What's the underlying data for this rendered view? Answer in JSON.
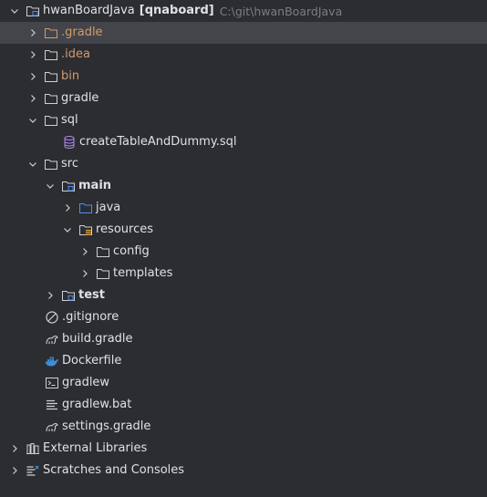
{
  "project": {
    "name": "hwanBoardJava",
    "module": "[qnaboard]",
    "path": "C:\\git\\hwanBoardJava"
  },
  "items": {
    "gradle_hidden": ".gradle",
    "idea": ".idea",
    "bin": "bin",
    "gradle": "gradle",
    "sql": "sql",
    "sql_file": "createTableAndDummy.sql",
    "src": "src",
    "main": "main",
    "java": "java",
    "resources": "resources",
    "config": "config",
    "templates": "templates",
    "test": "test",
    "gitignore": ".gitignore",
    "build_gradle": "build.gradle",
    "dockerfile": "Dockerfile",
    "gradlew": "gradlew",
    "gradlew_bat": "gradlew.bat",
    "settings_gradle": "settings.gradle",
    "external_libraries": "External Libraries",
    "scratches": "Scratches and Consoles"
  },
  "colors": {
    "background": "#2b2d30",
    "selected_row": "#43454a",
    "text": "#dfe1e5",
    "excluded_text": "#d39b6c",
    "secondary_text": "#7a7e85",
    "source_folder": "#548af7",
    "docker_blue": "#3d8fd8"
  }
}
